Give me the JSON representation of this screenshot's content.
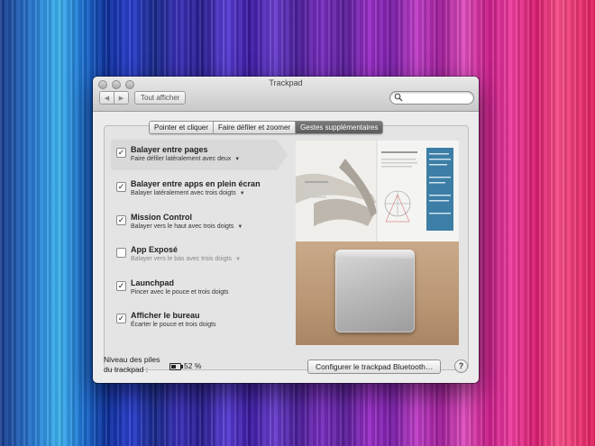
{
  "window": {
    "title": "Trackpad"
  },
  "toolbar": {
    "back_glyph": "◀",
    "forward_glyph": "▶",
    "show_all_label": "Tout afficher",
    "search_placeholder": ""
  },
  "tabs": [
    {
      "label": "Pointer et cliquer",
      "active": false
    },
    {
      "label": "Faire défiler et zoomer",
      "active": false
    },
    {
      "label": "Gestes supplémentaires",
      "active": true
    }
  ],
  "gestures": [
    {
      "title": "Balayer entre pages",
      "subtitle": "Faire défiler latéralement avec deux",
      "checked": true,
      "has_menu": true,
      "enabled": true,
      "selected": true
    },
    {
      "title": "Balayer entre apps en plein écran",
      "subtitle": "Balayer latéralement avec trois doigts",
      "checked": true,
      "has_menu": true,
      "enabled": true,
      "selected": false
    },
    {
      "title": "Mission Control",
      "subtitle": "Balayer vers le haut avec trois doigts",
      "checked": true,
      "has_menu": true,
      "enabled": true,
      "selected": false
    },
    {
      "title": "App Exposé",
      "subtitle": "Balayer vers le bas avec trois doigts",
      "checked": false,
      "has_menu": true,
      "enabled": false,
      "selected": false
    },
    {
      "title": "Launchpad",
      "subtitle": "Pincer avec le pouce et trois doigts",
      "checked": true,
      "has_menu": false,
      "enabled": true,
      "selected": false
    },
    {
      "title": "Afficher le bureau",
      "subtitle": "Écarter le pouce et trois doigts",
      "checked": true,
      "has_menu": false,
      "enabled": true,
      "selected": false
    }
  ],
  "footer": {
    "battery_label_line1": "Niveau des piles",
    "battery_label_line2": "du trackpad :",
    "battery_percent": "52 %",
    "battery_level": 0.52,
    "configure_button": "Configurer le trackpad Bluetooth…",
    "help_glyph": "?"
  },
  "icons": {
    "check": "✓",
    "caret": "▼"
  }
}
